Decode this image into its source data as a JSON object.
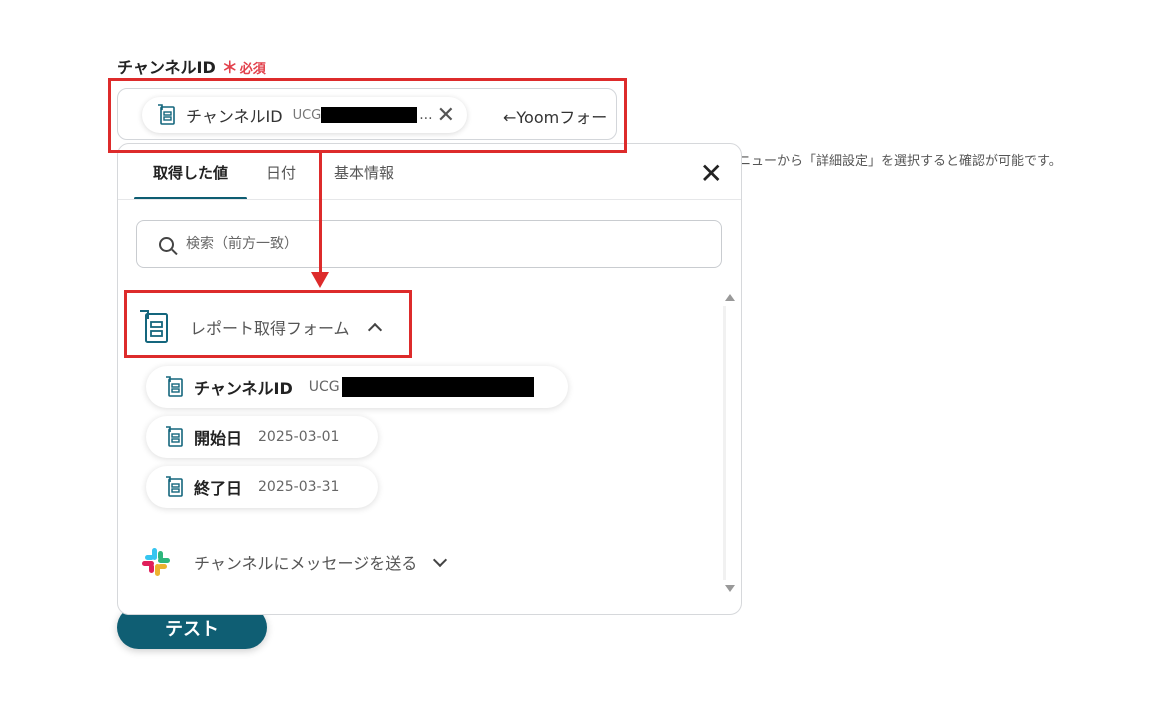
{
  "field": {
    "label": "チャンネルID",
    "required_star": "＊",
    "required_text": "必須",
    "chip_name": "チャンネルID",
    "chip_value_prefix": "UCG",
    "chip_ellipsis": "...",
    "chip_remove": "✕",
    "after_text": "←Yoomフォー"
  },
  "hint": "ニューから「詳細設定」を選択すると確認が可能です。",
  "panel": {
    "tabs": [
      {
        "label": "取得した値",
        "active": true
      },
      {
        "label": "日付",
        "active": false
      },
      {
        "label": "基本情報",
        "active": false
      }
    ],
    "close": "✕",
    "search": {
      "placeholder": "検索（前方一致）"
    },
    "groups": [
      {
        "title": "レポート取得フォーム",
        "expanded": true,
        "icon": "form-icon",
        "items": [
          {
            "name": "チャンネルID",
            "value": "UCG",
            "redacted": true
          },
          {
            "name": "開始日",
            "value": "2025-03-01"
          },
          {
            "name": "終了日",
            "value": "2025-03-31"
          }
        ]
      },
      {
        "title": "チャンネルにメッセージを送る",
        "expanded": false,
        "icon": "slack-icon"
      }
    ]
  },
  "test_button": "テスト",
  "colors": {
    "accent": "#0f5e73",
    "annotation_red": "#dd2b2b",
    "required_red": "#e2404b"
  }
}
